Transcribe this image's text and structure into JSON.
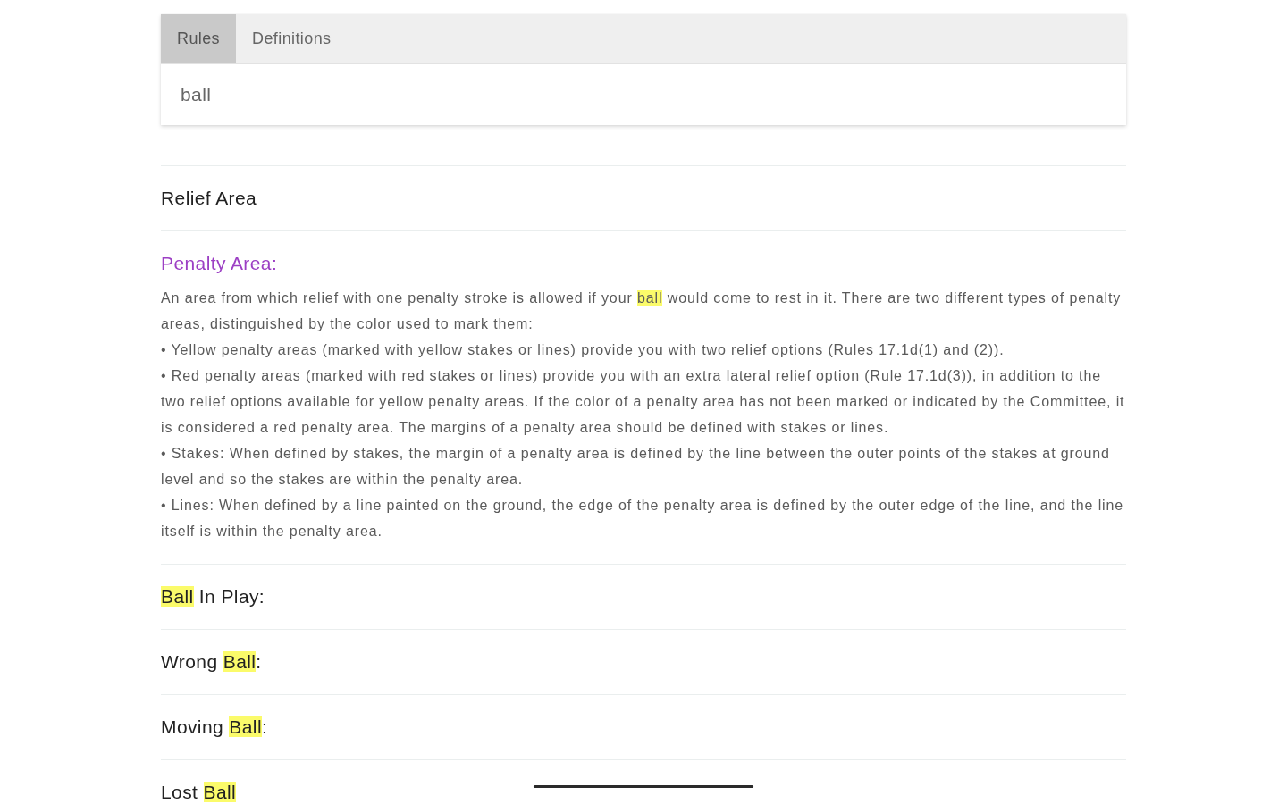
{
  "tabs": [
    {
      "label": "Rules",
      "selected": true
    },
    {
      "label": "Definitions",
      "selected": false
    }
  ],
  "search": {
    "value": "ball"
  },
  "entries": [
    {
      "expanded": false,
      "title": [
        {
          "text": "Relief Area",
          "highlighted": false
        }
      ]
    },
    {
      "expanded": true,
      "title": [
        {
          "text": "Penalty Area:",
          "highlighted": false
        }
      ],
      "body": [
        [
          {
            "text": "An area from which relief with one penalty stroke is allowed if your ",
            "highlighted": false
          },
          {
            "text": "ball",
            "highlighted": true
          },
          {
            "text": " would come to rest in it. There are two different types of penalty areas, distinguished by the color used to mark them:",
            "highlighted": false
          }
        ],
        [
          {
            "text": "• Yellow penalty areas (marked with yellow stakes or lines) provide you with two relief options (Rules 17.1d(1) and (2)).",
            "highlighted": false
          }
        ],
        [
          {
            "text": "• Red penalty areas (marked with red stakes or lines) provide you with an extra lateral relief option (Rule 17.1d(3)), in addition to the two relief options available for yellow penalty areas. If the color of a penalty area has not been marked or indicated by the Committee, it is considered a red penalty area. The margins of a penalty area should be defined with stakes or lines.",
            "highlighted": false
          }
        ],
        [
          {
            "text": "• Stakes: When defined by stakes, the margin of a penalty area is defined by the line between the outer points of the stakes at ground level and so the stakes are within the penalty area.",
            "highlighted": false
          }
        ],
        [
          {
            "text": "• Lines: When defined by a line painted on the ground, the edge of the penalty area is defined by the outer edge of the line, and the line itself is within the penalty area.",
            "highlighted": false
          }
        ]
      ]
    },
    {
      "expanded": false,
      "title": [
        {
          "text": "Ball",
          "highlighted": true
        },
        {
          "text": " In Play:",
          "highlighted": false
        }
      ]
    },
    {
      "expanded": false,
      "title": [
        {
          "text": "Wrong ",
          "highlighted": false
        },
        {
          "text": "Ball",
          "highlighted": true
        },
        {
          "text": ":",
          "highlighted": false
        }
      ]
    },
    {
      "expanded": false,
      "title": [
        {
          "text": "Moving ",
          "highlighted": false
        },
        {
          "text": "Ball",
          "highlighted": true
        },
        {
          "text": ":",
          "highlighted": false
        }
      ]
    },
    {
      "expanded": false,
      "title": [
        {
          "text": "Lost ",
          "highlighted": false
        },
        {
          "text": "Ball",
          "highlighted": true
        }
      ]
    }
  ]
}
